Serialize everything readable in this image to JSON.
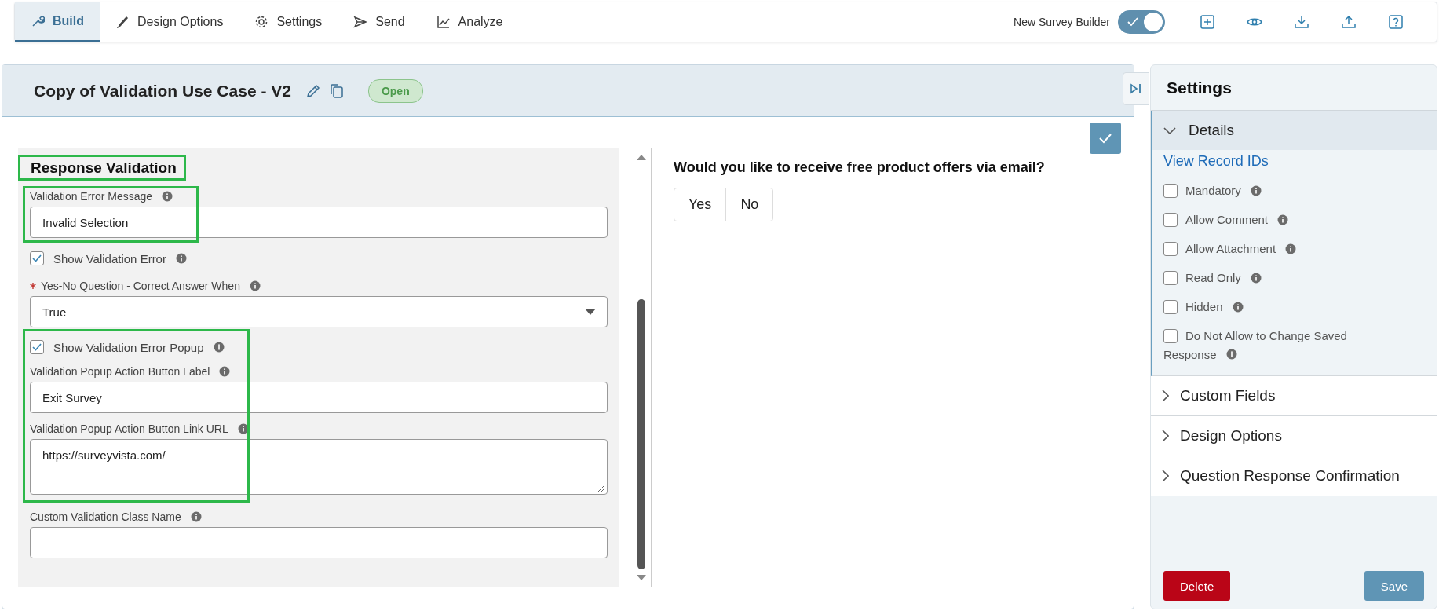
{
  "toolbar": {
    "tabs": [
      {
        "label": "Build",
        "selected": true
      },
      {
        "label": "Design Options",
        "selected": false
      },
      {
        "label": "Settings",
        "selected": false
      },
      {
        "label": "Send",
        "selected": false
      },
      {
        "label": "Analyze",
        "selected": false
      }
    ],
    "toggle": {
      "label": "New Survey Builder",
      "on": true
    }
  },
  "header": {
    "title": "Copy of Validation Use Case - V2",
    "status": "Open"
  },
  "form": {
    "heading": "Response Validation",
    "heading_highlighted": true,
    "fields": [
      {
        "kind": "text",
        "label": "Validation Error Message",
        "value": "Invalid Selection",
        "highlighted": true
      },
      {
        "kind": "checkbox",
        "label": "Show Validation Error",
        "checked": true
      },
      {
        "kind": "select",
        "label": "Yes-No Question - Correct Answer When",
        "required": true,
        "value": "True"
      },
      {
        "kind": "group",
        "highlighted": true,
        "children": [
          {
            "kind": "checkbox",
            "label": "Show Validation Error Popup",
            "checked": true
          },
          {
            "kind": "text",
            "label": "Validation Popup Action Button Label",
            "value": "Exit Survey"
          },
          {
            "kind": "textarea",
            "label": "Validation Popup Action Button Link URL",
            "value": "https://surveyvista.com/"
          }
        ]
      },
      {
        "kind": "text",
        "label": "Custom Validation Class Name"
      }
    ]
  },
  "preview": {
    "question": "Would you like to receive free product offers via email?",
    "options": [
      "Yes",
      "No"
    ]
  },
  "settings": {
    "title": "Settings",
    "sections": [
      {
        "label": "Details",
        "expanded": true,
        "link": "View Record IDs",
        "options": [
          {
            "label": "Mandatory",
            "checked": false
          },
          {
            "label": "Allow Comment",
            "checked": false
          },
          {
            "label": "Allow Attachment",
            "checked": false
          },
          {
            "label": "Read Only",
            "checked": false
          },
          {
            "label": "Hidden",
            "checked": false
          },
          {
            "label": "Do Not Allow to Change Saved",
            "label_2": "Response",
            "checked": false
          }
        ]
      },
      {
        "label": "Custom Fields",
        "expanded": false
      },
      {
        "label": "Design Options",
        "expanded": false
      },
      {
        "label": "Question Response Confirmation",
        "expanded": false
      }
    ],
    "buttons": [
      {
        "label": "Delete",
        "kind": "danger"
      },
      {
        "label": "Save",
        "kind": "primary"
      }
    ]
  }
}
